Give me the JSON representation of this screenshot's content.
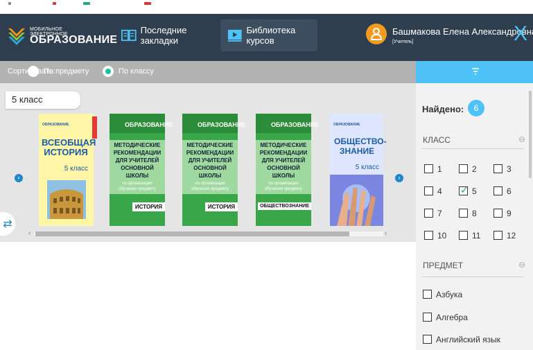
{
  "header": {
    "logo_small": "МОБИЛЬНОЕ ЭЛЕКТРОННОЕ",
    "logo_big": "ОБРАЗОВАНИЕ",
    "nav_bookmarks": "Последние закладки",
    "nav_library": "Библиотека курсов",
    "user_name": "Башмакова Елена Александровна",
    "user_role": "[Учитель]",
    "close_glyph": "X"
  },
  "sort": {
    "label": "Сортировать:",
    "option_subject": "По предмету",
    "option_grade": "По классу",
    "selected": "По классу"
  },
  "shelf": {
    "grade_label": "5 класс",
    "books": [
      {
        "cover": "history",
        "publisher": "ОБРАЗОВАНИЕ",
        "title": "ВСЕОБЩАЯ ИСТОРИЯ",
        "grade": "5 класс"
      },
      {
        "cover": "methodical",
        "publisher": "ОБРАЗОВАНИЕ",
        "subject": "ИСТОРИЯ"
      },
      {
        "cover": "methodical",
        "publisher": "ОБРАЗОВАНИЕ",
        "subject": "ИСТОРИЯ"
      },
      {
        "cover": "methodical",
        "publisher": "ОБРАЗОВАНИЕ",
        "subject": "ОБЩЕСТВОЗНАНИЕ"
      },
      {
        "cover": "social",
        "publisher": "ОБРАЗОВАНИЕ",
        "title": "ОБЩЕСТВО-ЗНАНИЕ",
        "grade": "5 класс"
      }
    ],
    "method_lines": [
      "МЕТОДИЧЕСКИЕ",
      "РЕКОМЕНДАЦИИ",
      "ДЛЯ УЧИТЕЛЕЙ",
      "ОСНОВНОЙ ШКОЛЫ"
    ],
    "method_sub": [
      "по организации",
      "обучения предмету"
    ]
  },
  "filter": {
    "found_label": "Найдено:",
    "found_count": "6",
    "grade_section": "КЛАСС",
    "grades": [
      "1",
      "2",
      "3",
      "4",
      "5",
      "6",
      "7",
      "8",
      "9",
      "10",
      "11",
      "12"
    ],
    "checked_grade": "5",
    "subject_section": "ПРЕДМЕТ",
    "subjects": [
      "Азбука",
      "Алгебра",
      "Английский язык"
    ]
  },
  "colors": {
    "header_bg": "#2f3e4e",
    "accent": "#4fc3f7",
    "method_green": "#3aa64a",
    "radio_green": "#19c3a0"
  }
}
